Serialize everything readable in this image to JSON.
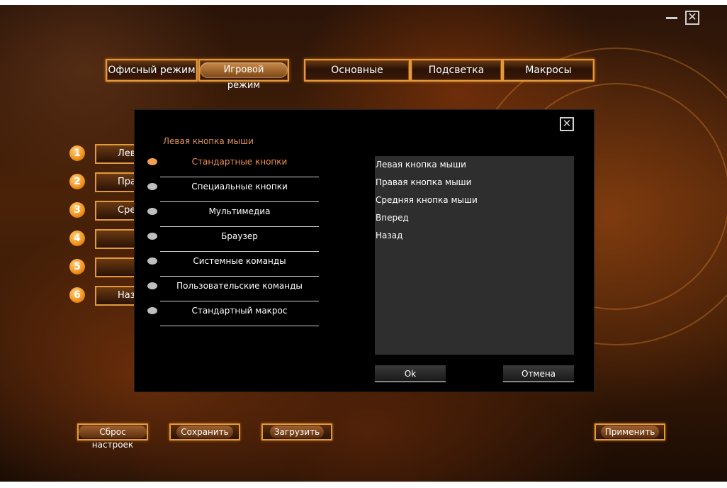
{
  "window": {
    "minimize_symbol": "—",
    "close_symbol": "✕"
  },
  "modes": {
    "office": "Офисный режим",
    "game": "Игровой режим"
  },
  "tabs": [
    {
      "label": "Основные"
    },
    {
      "label": "Подсветка"
    },
    {
      "label": "Макросы"
    }
  ],
  "button_rows": [
    {
      "number": "1",
      "label": "Левая кнопка мыши"
    },
    {
      "number": "2",
      "label": "Правая кнопка мыши"
    },
    {
      "number": "3",
      "label": "Средняя кнопка мыши"
    },
    {
      "number": "4",
      "label": ""
    },
    {
      "number": "5",
      "label": ""
    },
    {
      "number": "6",
      "label": "Назад"
    }
  ],
  "bottom_buttons": {
    "reset": "Сброс настроек",
    "save": "Сохранить",
    "load": "Загрузить",
    "apply": "Применить"
  },
  "dialog": {
    "close_symbol": "✕",
    "title": "Левая кнопка мыши",
    "categories": [
      {
        "label": "Стандартные кнопки",
        "selected": true
      },
      {
        "label": "Специальные кнопки",
        "selected": false
      },
      {
        "label": "Мультимедиа",
        "selected": false
      },
      {
        "label": "Браузер",
        "selected": false
      },
      {
        "label": "Системные команды",
        "selected": false
      },
      {
        "label": "Пользовательские команды",
        "selected": false
      },
      {
        "label": "Стандартный макрос",
        "selected": false
      }
    ],
    "options": [
      "Левая кнопка мыши",
      "Правая кнопка мыши",
      "Средняя кнопка мыши",
      "Вперед",
      "Назад"
    ],
    "ok_label": "Ok",
    "cancel_label": "Отмена"
  },
  "colors": {
    "accent": "#e29a3c",
    "selected_text": "#f09050",
    "dialog_bg": "#000000",
    "list_bg": "#2e2e2e"
  }
}
